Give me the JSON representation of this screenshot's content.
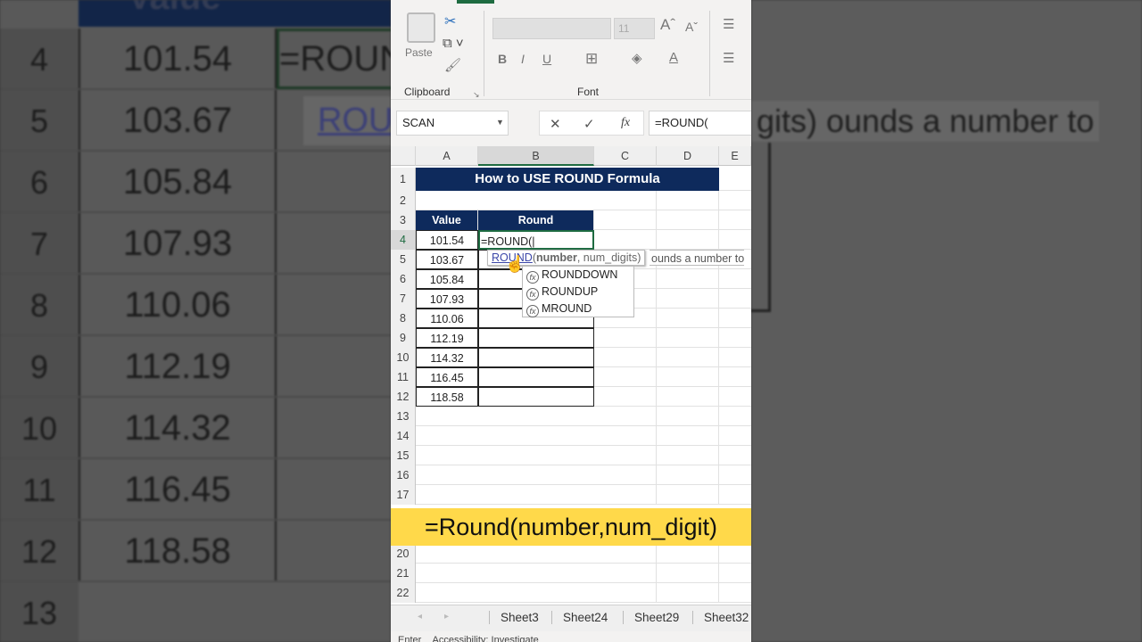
{
  "ribbon": {
    "paste": "Paste",
    "font_size": "11",
    "clipboard_group": "Clipboard",
    "font_group": "Font",
    "bold": "B",
    "italic": "I",
    "underline": "U"
  },
  "formula_bar": {
    "name_box": "SCAN",
    "cancel": "✕",
    "enter": "✓",
    "fx": "fx",
    "formula": "=ROUND("
  },
  "columns": [
    "A",
    "B",
    "C",
    "D",
    "E"
  ],
  "sheet": {
    "title": "How to USE ROUND Formula",
    "header_value": "Value",
    "header_round": "Round",
    "editing": "=ROUND(",
    "values": [
      "101.54",
      "103.67",
      "105.84",
      "107.93",
      "110.06",
      "112.19",
      "114.32",
      "116.45",
      "118.58"
    ],
    "row_numbers": [
      "1",
      "2",
      "3",
      "4",
      "5",
      "6",
      "7",
      "8",
      "9",
      "10",
      "11",
      "12",
      "13",
      "14",
      "15",
      "16",
      "17",
      "20",
      "21",
      "22"
    ]
  },
  "tooltip": {
    "fn": "ROUND",
    "args_bold": "number",
    "args_rest": ", num_digits)",
    "open": "(",
    "desc": "ounds a number to"
  },
  "autocomplete": [
    "ROUNDDOWN",
    "ROUNDUP",
    "MROUND"
  ],
  "banner": "=Round(number,num_digit)",
  "sheet_tabs": [
    "Sheet3",
    "Sheet24",
    "Sheet29",
    "Sheet32"
  ],
  "status": {
    "mode": "Enter",
    "accessibility": "Accessibility: Investigate"
  },
  "background": {
    "header": "Value",
    "formula": "=ROUN",
    "tip": "ROUN",
    "right_text": "gits)  ounds a number to",
    "rows": [
      "4",
      "5",
      "6",
      "7",
      "8",
      "9",
      "10",
      "11",
      "12",
      "13"
    ]
  }
}
